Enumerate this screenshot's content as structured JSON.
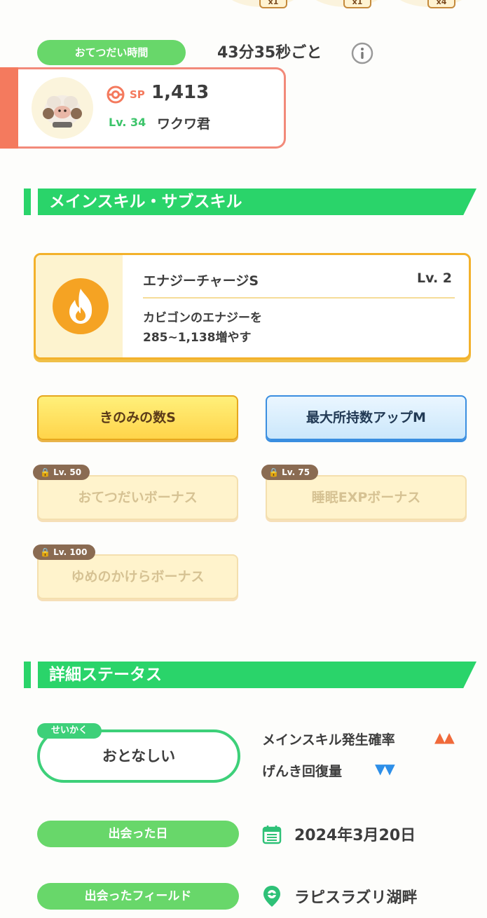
{
  "top_items": {
    "badges": [
      "x1",
      "x1",
      "x4"
    ]
  },
  "helper": {
    "time_label": "おてつだい時間",
    "time_value": "43分35秒ごと",
    "sp_label": "SP",
    "sp_value": "1,413",
    "level": "Lv. 34",
    "nickname": "ワクワ君"
  },
  "skills_section": {
    "title": "メインスキル・サブスキル",
    "main_skill": {
      "name": "エナジーチャージS",
      "level": "Lv. 2",
      "desc_line1": "カビゴンのエナジーを",
      "desc_line2": "285~1,138増やす",
      "icon": "flame-icon",
      "color": "#f5a323"
    },
    "sub_skills": [
      {
        "label": "きのみの数S",
        "lock": "",
        "style": "yellow"
      },
      {
        "label": "最大所持数アップM",
        "lock": "",
        "style": "blue"
      },
      {
        "label": "おてつだいボーナス",
        "lock": "Lv. 50",
        "style": "locked"
      },
      {
        "label": "睡眠EXPボーナス",
        "lock": "Lv. 75",
        "style": "locked"
      },
      {
        "label": "ゆめのかけらボーナス",
        "lock": "Lv. 100",
        "style": "locked"
      }
    ]
  },
  "status_section": {
    "title": "詳細ステータス",
    "nature_tag": "せいかく",
    "nature": "おとなしい",
    "nature_up": "メインスキル発生確率",
    "nature_up_mark": "▲▲",
    "nature_down": "げんき回復量",
    "nature_down_mark": "▼▼",
    "met_date_label": "出会った日",
    "met_date": "2024年3月20日",
    "met_field_label": "出会ったフィールド",
    "met_field": "ラピスラズリ湖畔"
  },
  "colors": {
    "accent_green": "#2ad46a",
    "pill_green": "#68d76a",
    "up_red": "#f06a3a",
    "down_blue": "#2e8fe8"
  }
}
